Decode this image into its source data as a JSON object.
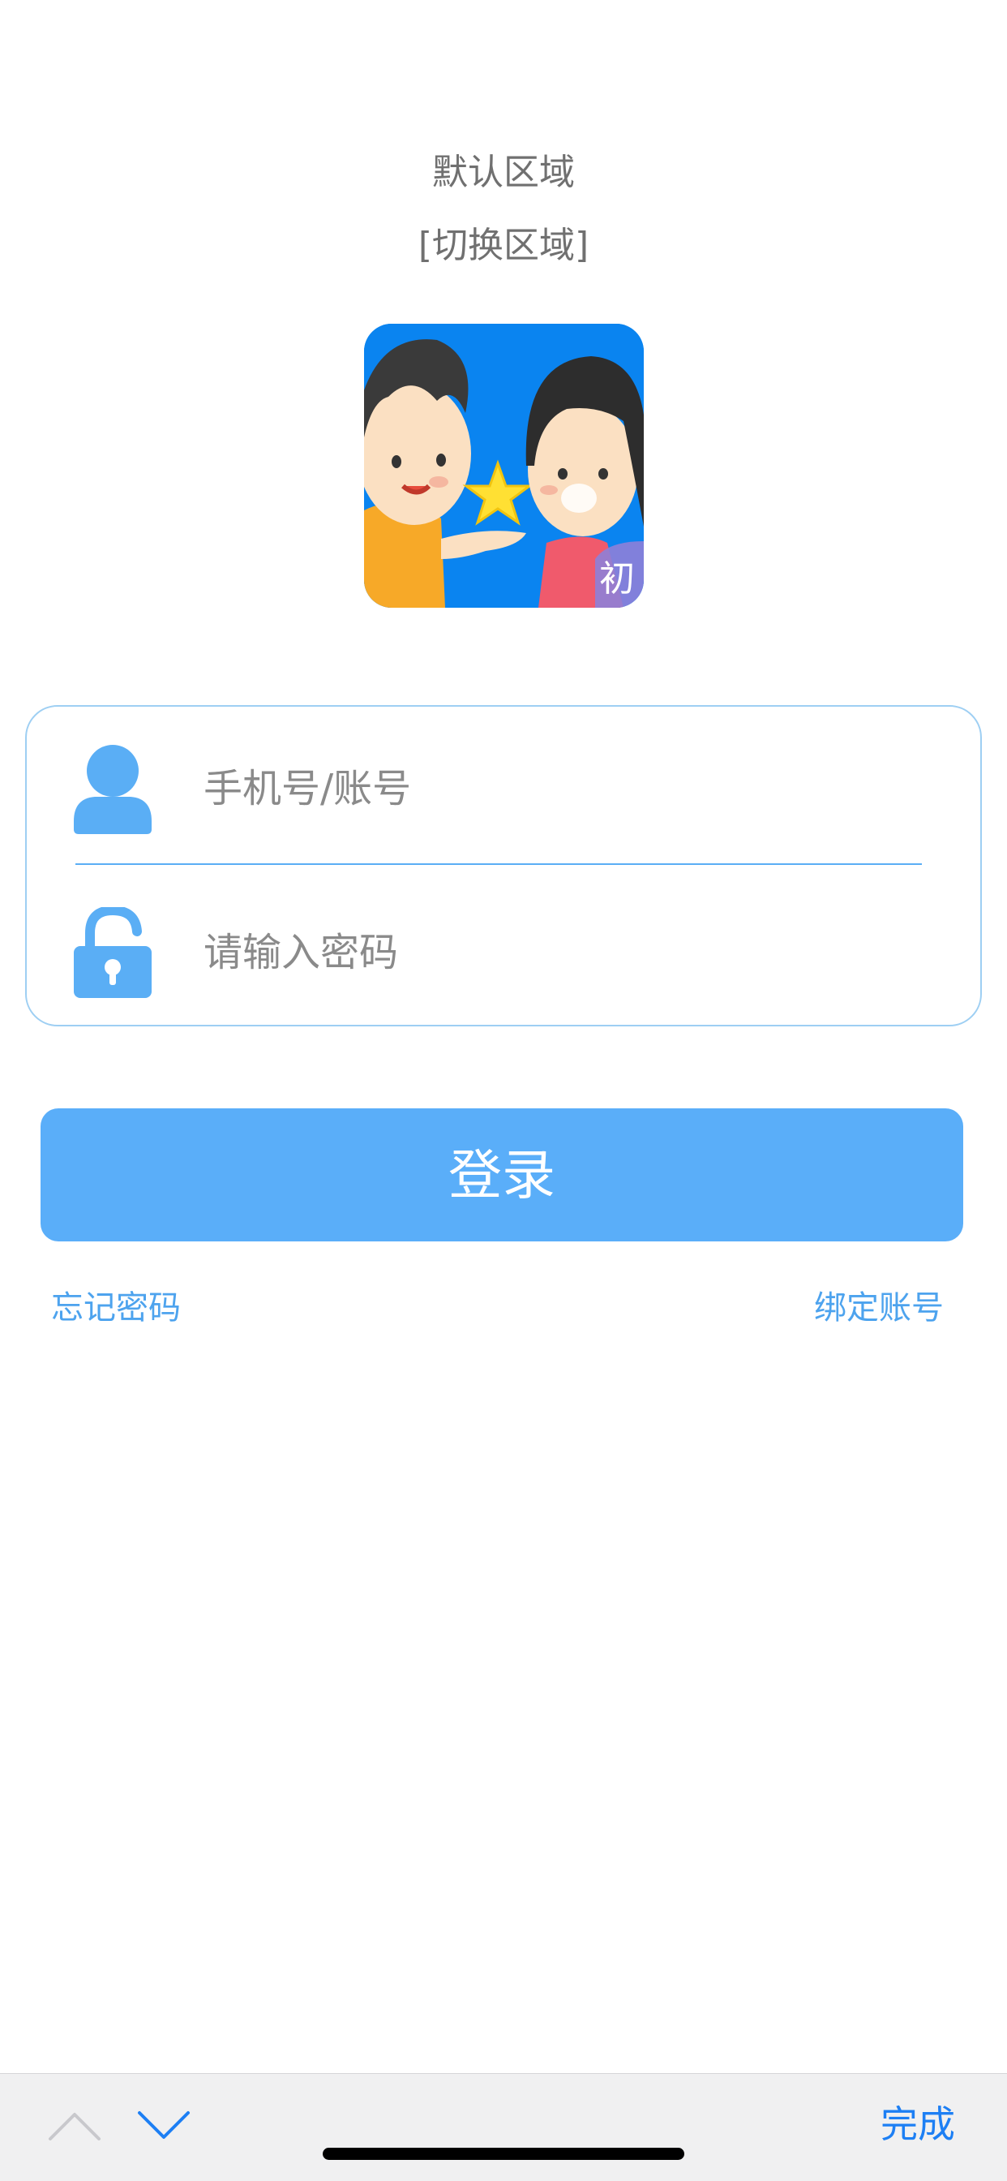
{
  "header": {
    "region_label": "默认区域",
    "region_switch_label": "[切换区域]"
  },
  "logo": {
    "badge_text": "初",
    "colors": {
      "background": "#0a84f0"
    }
  },
  "form": {
    "username": {
      "placeholder": "手机号/账号",
      "value": "",
      "icon": "user-icon"
    },
    "password": {
      "placeholder": "请输入密码",
      "value": "",
      "icon": "unlock-icon"
    }
  },
  "actions": {
    "login_label": "登录",
    "forgot_password_label": "忘记密码",
    "bind_account_label": "绑定账号"
  },
  "keyboard_toolbar": {
    "prev_icon": "chevron-up-icon",
    "next_icon": "chevron-down-icon",
    "done_label": "完成"
  },
  "colors": {
    "accent": "#5aaef9",
    "link": "#4da3ee",
    "toolbar_done": "#1d7ff4"
  }
}
